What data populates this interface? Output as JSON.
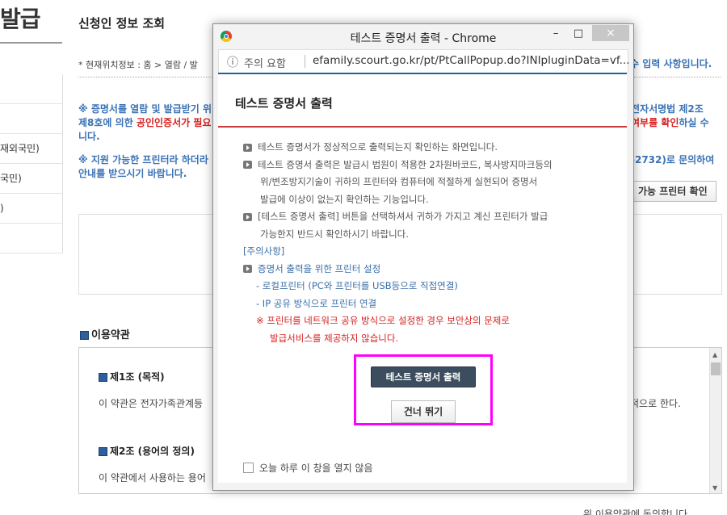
{
  "page": {
    "big_title": "발급",
    "side_items": [
      "",
      "",
      "재외국민)",
      "국민)",
      ")",
      ""
    ],
    "title": "신청인 정보 조회",
    "location": "* 현재위치정보 : 홈 > 열람 / 발",
    "required_note": "수 입력 사항입니다.",
    "notice1_a": "※ 증명서를 열람 및 발급받기 위",
    "notice1_b": "제8호에 의한 ",
    "notice1_red": "공인인증서가 필요",
    "notice1_c": "니다.",
    "notice1_right1": "전자서명법 제2조",
    "notice1_right2_red": "여부를 확인",
    "notice1_right2": "하실 수",
    "notice2_a": "※ 지원 가능한 프린터라 하더라",
    "notice2_b": "안내를 받으시기 바랍니다.",
    "notice2_right": "-2732)로 문의하여",
    "printer_check_button": "가능 프린터 확인",
    "terms_section": "이용약관",
    "article1_title": "제1조 (목적)",
    "article1_text": "이 약관은 전자가족관계등",
    "article1_text_right": "적으로 한다.",
    "article2_title": "제2조 (용어의 정의)",
    "article2_text": "이 약관에서 사용하는 용어",
    "agree_text": "위 이용약관에 동의합니다."
  },
  "popup": {
    "window_title": "테스트 증명서 출력 - Chrome",
    "minimize": "–",
    "maximize": "□",
    "close": "×",
    "addr_info": "ⓘ",
    "addr_warning": "주의 요함",
    "url": "efamily.scourt.go.kr/pt/PtCallPopup.do?INIpluginData=vf...",
    "heading": "테스트 증명서 출력",
    "lines": [
      "테스트 증명서가 정상적으로 출력되는지 확인하는 화면입니다.",
      "테스트 증명서 출력은 발급시 법원이 적용한 2차원바코드, 복사방지마크등의",
      "위/변조방지기술이 귀하의 프린터와 컴퓨터에 적절하게 실현되어 증명서",
      "발급에 이상이 없는지 확인하는 기능입니다.",
      "[테스트 증명서 출력] 버튼을 선택하셔서 귀하가 가지고 계신 프린터가 발급",
      "가능한지 반드시 확인하시기 바랍니다."
    ],
    "caution_title": "[주의사항]",
    "printer_setting": "증명서 출력을 위한 프린터 설정",
    "sub1": "- 로컬프린터 (PC와 프린터를 USB등으로 직접연결)",
    "sub2": "- IP 공유 방식으로 프린터 연결",
    "warn1": "※ 프린터를 네트워크 공유 방식으로 설정한 경우 보안상의 문제로",
    "warn2": "발급서비스를 제공하지 않습니다.",
    "print_button": "테스트 증명서 출력",
    "skip_button": "건너 뛰기",
    "checkbox_label": "오늘 하루 이 창을 열지 않음"
  },
  "colors": {
    "highlight": "#ff00ff",
    "blue_text": "#3a72b5",
    "red_text": "#d62020"
  }
}
